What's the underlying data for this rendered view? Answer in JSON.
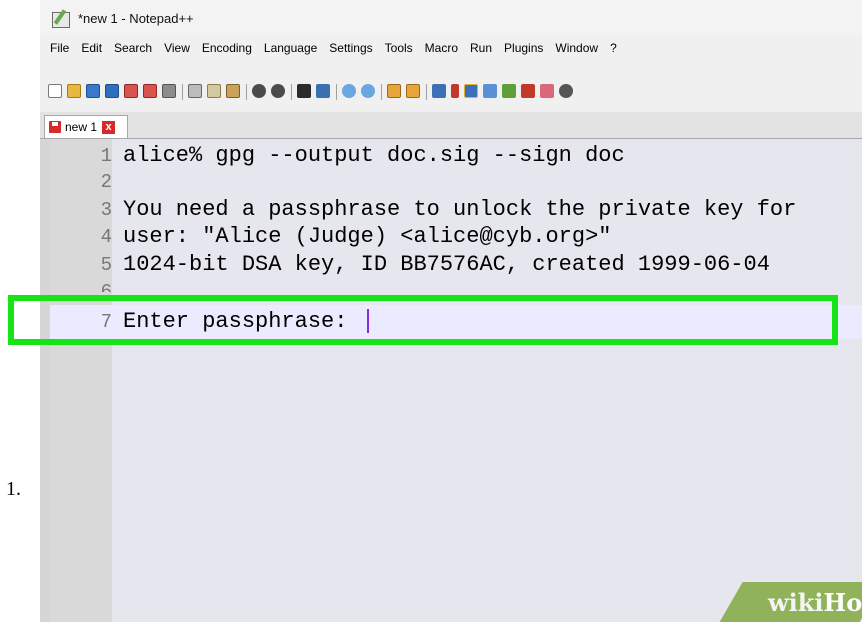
{
  "step_number": "1.",
  "window": {
    "title": "*new 1 - Notepad++"
  },
  "menu": [
    "File",
    "Edit",
    "Search",
    "View",
    "Encoding",
    "Language",
    "Settings",
    "Tools",
    "Macro",
    "Run",
    "Plugins",
    "Window",
    "?"
  ],
  "tab": {
    "label": "new 1",
    "close_label": "x"
  },
  "editor": {
    "lines": [
      {
        "num": "1",
        "text": "alice% gpg --output doc.sig --sign doc"
      },
      {
        "num": "2",
        "text": ""
      },
      {
        "num": "3",
        "text": "You need a passphrase to unlock the private key for"
      },
      {
        "num": "4",
        "text": "user: \"Alice (Judge) <alice@cyb.org>\""
      },
      {
        "num": "5",
        "text": "1024-bit DSA key, ID BB7576AC, created 1999-06-04"
      },
      {
        "num": "6",
        "text": ""
      },
      {
        "num": "7",
        "text": "Enter passphrase: "
      }
    ]
  },
  "watermark": {
    "prefix": "wiki",
    "suffix": "How"
  },
  "colors": {
    "highlight": "#17e417",
    "caret": "#8a2be2",
    "watermark_bg": "#8fb25a"
  }
}
